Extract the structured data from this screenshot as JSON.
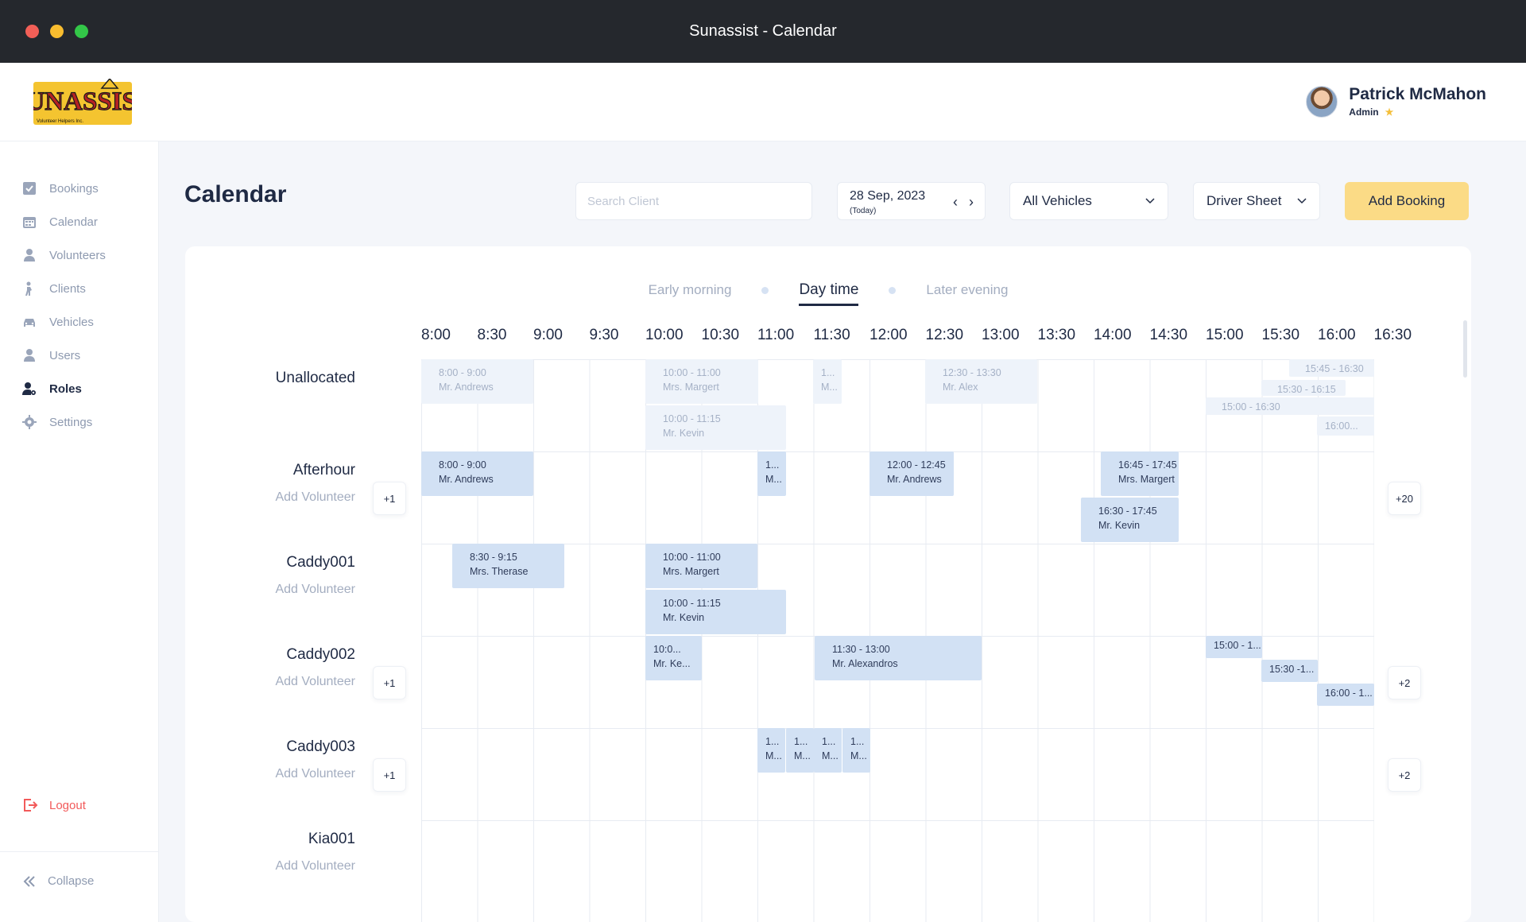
{
  "window": {
    "title": "Sunassist - Calendar"
  },
  "user": {
    "name": "Patrick McMahon",
    "role": "Admin",
    "star": "★"
  },
  "sidebar": {
    "items": [
      {
        "label": "Bookings",
        "icon": "bookings-icon"
      },
      {
        "label": "Calendar",
        "icon": "calendar-icon"
      },
      {
        "label": "Volunteers",
        "icon": "volunteer-icon"
      },
      {
        "label": "Clients",
        "icon": "clients-icon"
      },
      {
        "label": "Vehicles",
        "icon": "car-icon"
      },
      {
        "label": "Users",
        "icon": "user-icon"
      },
      {
        "label": "Roles",
        "icon": "roles-icon"
      },
      {
        "label": "Settings",
        "icon": "gear-icon"
      }
    ],
    "active": "Roles",
    "logout": "Logout",
    "collapse": "Collapse"
  },
  "page": {
    "title": "Calendar"
  },
  "toolbar": {
    "search_placeholder": "Search Client",
    "date": "28 Sep, 2023",
    "date_sub": "(Today)",
    "vehicles": "All Vehicles",
    "sheet": "Driver Sheet",
    "add": "Add Booking"
  },
  "periods": [
    "Early morning",
    "Day time",
    "Later evening"
  ],
  "active_period": "Day time",
  "hours": [
    "8:00",
    "8:30",
    "9:00",
    "9:30",
    "10:00",
    "10:30",
    "11:00",
    "11:30",
    "12:00",
    "12:30",
    "13:00",
    "13:30",
    "14:00",
    "14:30",
    "15:00",
    "15:30",
    "16:00",
    "16:30"
  ],
  "rows": [
    {
      "name": "Unallocated",
      "add": ""
    },
    {
      "name": "Afterhour",
      "add": "Add Volunteer",
      "left_more": "+1",
      "right_more": "+20"
    },
    {
      "name": "Caddy001",
      "add": "Add Volunteer"
    },
    {
      "name": "Caddy002",
      "add": "Add Volunteer",
      "left_more": "+1",
      "right_more": "+2"
    },
    {
      "name": "Caddy003",
      "add": "Add Volunteer",
      "left_more": "+1",
      "right_more": "+2"
    },
    {
      "name": "Kia001",
      "add": "Add Volunteer"
    }
  ],
  "events": [
    {
      "row": 0,
      "time": "8:00 - 9:00",
      "client": "Mr. Andrews",
      "faded": true
    },
    {
      "row": 0,
      "time": "10:00 - 11:00",
      "client": "Mrs. Margert",
      "faded": true
    },
    {
      "row": 0,
      "time": "10:00 - 11:15",
      "client": "Mr. Kevin",
      "faded": true
    },
    {
      "row": 0,
      "time": "1...",
      "client": "M...",
      "faded": true
    },
    {
      "row": 0,
      "time": "12:30 - 13:30",
      "client": "Mr. Alex",
      "faded": true
    },
    {
      "row": 0,
      "time": "15:45 - 16:30",
      "client": "",
      "faded": true
    },
    {
      "row": 0,
      "time": "15:30 - 16:15",
      "client": "",
      "faded": true
    },
    {
      "row": 0,
      "time": "15:00 - 16:30",
      "client": "",
      "faded": true
    },
    {
      "row": 0,
      "time": "16:00...",
      "client": "",
      "faded": true
    },
    {
      "row": 1,
      "time": "8:00 - 9:00",
      "client": "Mr. Andrews"
    },
    {
      "row": 1,
      "time": "1...",
      "client": "M..."
    },
    {
      "row": 1,
      "time": "12:00 - 12:45",
      "client": "Mr. Andrews"
    },
    {
      "row": 1,
      "time": "16:45 - 17:45",
      "client": "Mrs. Margert"
    },
    {
      "row": 1,
      "time": "16:30 - 17:45",
      "client": "Mr. Kevin"
    },
    {
      "row": 2,
      "time": "8:30 - 9:15",
      "client": "Mrs. Therase"
    },
    {
      "row": 2,
      "time": "10:00 - 11:00",
      "client": "Mrs. Margert"
    },
    {
      "row": 2,
      "time": "10:00 - 11:15",
      "client": "Mr. Kevin"
    },
    {
      "row": 3,
      "time": "10:0...",
      "client": "Mr. Ke..."
    },
    {
      "row": 3,
      "time": "11:30 - 13:00",
      "client": "Mr. Alexandros"
    },
    {
      "row": 3,
      "time": "15:00 - 1...",
      "client": ""
    },
    {
      "row": 3,
      "time": "15:30 -1...",
      "client": ""
    },
    {
      "row": 3,
      "time": "16:00 - 1...",
      "client": ""
    },
    {
      "row": 4,
      "time": "1...",
      "client": "M..."
    },
    {
      "row": 4,
      "time": "1...",
      "client": "M..."
    },
    {
      "row": 4,
      "time": "1...",
      "client": "M..."
    },
    {
      "row": 4,
      "time": "1...",
      "client": "M..."
    }
  ]
}
